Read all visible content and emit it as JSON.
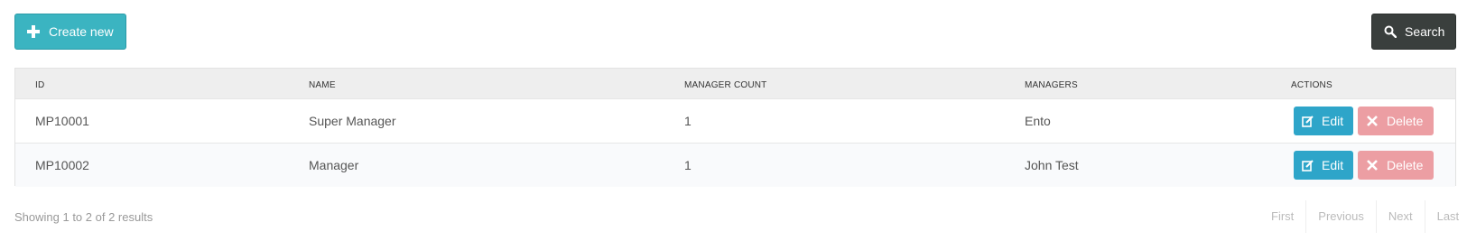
{
  "toolbar": {
    "create_label": "Create new",
    "search_label": "Search"
  },
  "table": {
    "headers": {
      "id": "ID",
      "name": "NAME",
      "manager_count": "MANAGER COUNT",
      "managers": "MANAGERS",
      "actions": "ACTIONS"
    },
    "rows": [
      {
        "id": "MP10001",
        "name": "Super Manager",
        "manager_count": "1",
        "managers": "Ento"
      },
      {
        "id": "MP10002",
        "name": "Manager",
        "manager_count": "1",
        "managers": "John Test"
      }
    ],
    "edit_label": "Edit",
    "delete_label": "Delete"
  },
  "footer": {
    "summary": "Showing 1 to 2 of 2 results",
    "pagination": {
      "first": "First",
      "previous": "Previous",
      "next": "Next",
      "last": "Last"
    }
  },
  "colors": {
    "create_button": "#3bb4c1",
    "search_button": "#3a3f3d",
    "edit_button": "#2ea5c9",
    "delete_button": "#ec9ea3",
    "header_bg": "#eeeeee"
  },
  "icons": {
    "create": "plus-icon",
    "search": "search-icon",
    "edit": "edit-icon",
    "delete": "close-icon"
  }
}
